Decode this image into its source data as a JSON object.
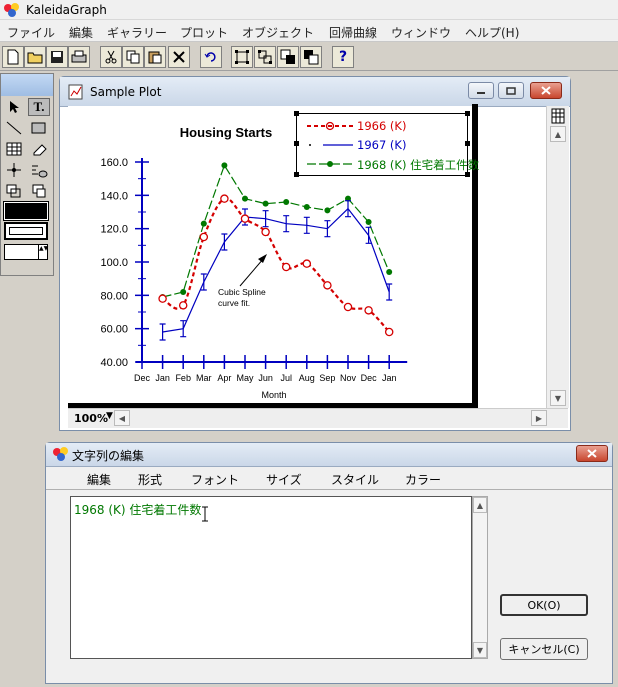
{
  "app": {
    "title": "KaleidaGraph",
    "menu": [
      "ファイル",
      "編集",
      "ギャラリー",
      "プロット",
      "オブジェクト",
      "回帰曲線",
      "ウィンドウ",
      "ヘルプ(H)"
    ]
  },
  "toolbar": {
    "icons": [
      "new-file-icon",
      "open-folder-icon",
      "save-icon",
      "print-icon",
      "cut-icon",
      "copy-icon",
      "paste-icon",
      "delete-icon",
      "undo-icon",
      "group-icon",
      "ungroup-icon",
      "bring-front-icon",
      "send-back-icon",
      "help-icon"
    ],
    "help_label": "?"
  },
  "plot_window": {
    "title": "Sample Plot",
    "zoom": "100%"
  },
  "chart_data": {
    "type": "line",
    "title": "Housing Starts",
    "xlabel": "Month",
    "ylabel": "",
    "categories": [
      "Dec",
      "Jan",
      "Feb",
      "Mar",
      "Apr",
      "May",
      "Jun",
      "Jul",
      "Aug",
      "Sep",
      "Nov",
      "Dec",
      "Jan"
    ],
    "yticks": [
      "160.0",
      "140.0",
      "120.0",
      "100.0",
      "80.00",
      "60.00",
      "40.00"
    ],
    "ylim": [
      40,
      160
    ],
    "series": [
      {
        "name": "1966 (K)",
        "color": "#d40000",
        "values": [
          null,
          78,
          74,
          115,
          138,
          126,
          118,
          97,
          99,
          86,
          73,
          71,
          58
        ]
      },
      {
        "name": "1967 (K)",
        "color": "#0000c0",
        "values": [
          null,
          58,
          60,
          88,
          112,
          127,
          126,
          123,
          122,
          120,
          132,
          116,
          82
        ]
      },
      {
        "name": "1968 (K) 住宅着工件数",
        "color": "#007800",
        "values": [
          null,
          79,
          82,
          123,
          158,
          138,
          135,
          136,
          133,
          131,
          138,
          124,
          94
        ]
      }
    ],
    "annotation": [
      "Cubic Spline",
      "curve fit."
    ],
    "legend": "top-right"
  },
  "dialog": {
    "title": "文字列の編集",
    "menu": [
      "編集",
      "形式",
      "フォント",
      "サイズ",
      "スタイル",
      "カラー"
    ],
    "text": "1968 (K) 住宅着工件数",
    "text_color": "#007800",
    "ok_label": "OK(O)",
    "cancel_label": "キャンセル(C)"
  }
}
